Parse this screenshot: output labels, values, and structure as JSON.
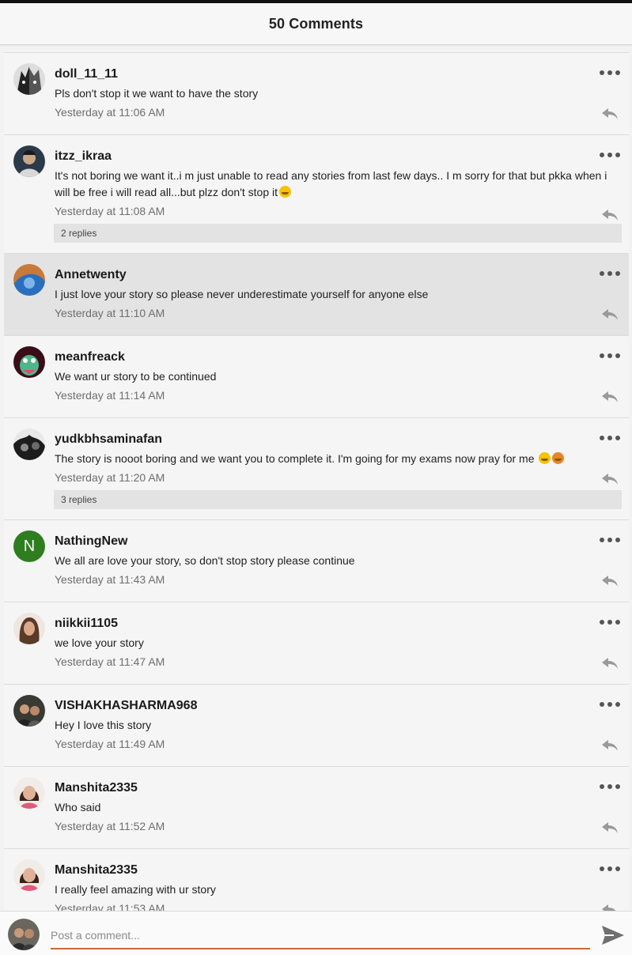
{
  "header": {
    "title": "50 Comments"
  },
  "comments": [
    {
      "username": "doll_11_11",
      "text": "Pls don't stop it we want to have the story",
      "time": "Yesterday at 11:06 AM"
    },
    {
      "username": "itzz_ikraa",
      "text": "It's not boring we want it..i m just unable to read any stories from last few days.. I m sorry for that but pkka when i will be free i will read all...but plzz don't stop it",
      "time": "Yesterday at 11:08 AM",
      "replies": "2 replies"
    },
    {
      "username": "Annetwenty",
      "text": "I just love your story so please never underestimate yourself for anyone else",
      "time": "Yesterday at 11:10 AM"
    },
    {
      "username": "meanfreack",
      "text": "We want ur story to be continued",
      "time": "Yesterday at 11:14 AM"
    },
    {
      "username": "yudkbhsaminafan",
      "text": "The story is nooot boring and we want you to complete it. I'm going for my exams now pray for me",
      "time": "Yesterday at 11:20 AM",
      "replies": "3 replies"
    },
    {
      "username": "NathingNew",
      "avatar_letter": "N",
      "text": "We all are love your story,  so don't stop story please continue",
      "time": "Yesterday at 11:43 AM"
    },
    {
      "username": "niikkii1105",
      "text": "we love your story",
      "time": "Yesterday at 11:47 AM"
    },
    {
      "username": "VISHAKHASHARMA968",
      "text": "Hey I love this story",
      "time": "Yesterday at 11:49 AM"
    },
    {
      "username": "Manshita2335",
      "text": "Who said",
      "time": "Yesterday at 11:52 AM"
    },
    {
      "username": "Manshita2335",
      "text": "I really feel amazing with ur story",
      "time": "Yesterday at 11:53 AM"
    }
  ],
  "composer": {
    "placeholder": "Post a comment..."
  },
  "colors": {
    "accent": "#c86a36",
    "avatar_letter_bg": "#2e7d1f",
    "selected_row": "#e3e3e3"
  },
  "icons": {
    "more": "more-horizontal-icon",
    "reply": "reply-arrow-icon",
    "send": "send-icon"
  }
}
